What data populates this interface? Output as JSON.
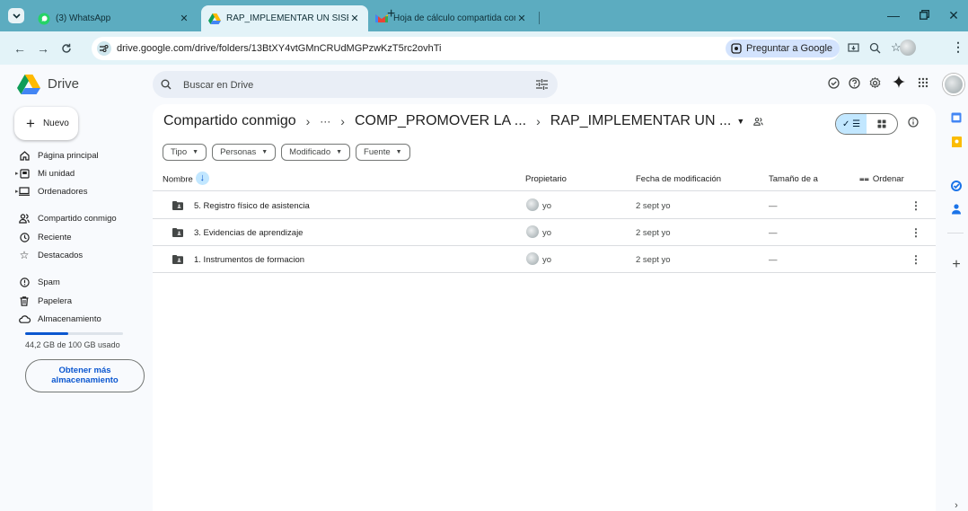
{
  "browser": {
    "tabs": [
      {
        "title": "(3) WhatsApp",
        "icon": "whatsapp-icon",
        "active": false
      },
      {
        "title": "RAP_IMPLEMENTAR UN SISEM",
        "icon": "drive-icon",
        "active": true
      },
      {
        "title": "Hoja de cálculo compartida con",
        "icon": "gmail-icon",
        "active": false
      }
    ],
    "url": "drive.google.com/drive/folders/13BtXY4vtGMnCRUdMGPzwKzT5rc2ovhTi",
    "ask_google": "Preguntar a Google",
    "colors": {
      "tabstrip": "#5cacc0",
      "toolbar": "#e3f3f8"
    }
  },
  "header": {
    "app_name": "Drive",
    "search_placeholder": "Buscar en Drive"
  },
  "sidebar": {
    "new_label": "Nuevo",
    "items": [
      {
        "label": "Página principal",
        "icon": "home-icon"
      },
      {
        "label": "Mi unidad",
        "icon": "my-drive-icon"
      },
      {
        "label": "Ordenadores",
        "icon": "computers-icon"
      },
      {
        "label": "Compartido conmigo",
        "icon": "shared-icon"
      },
      {
        "label": "Reciente",
        "icon": "clock-icon"
      },
      {
        "label": "Destacados",
        "icon": "star-icon"
      },
      {
        "label": "Spam",
        "icon": "spam-icon"
      },
      {
        "label": "Papelera",
        "icon": "trash-icon"
      },
      {
        "label": "Almacenamiento",
        "icon": "cloud-icon"
      }
    ],
    "storage_text": "44,2 GB de 100 GB usado",
    "storage_fraction": 0.442,
    "get_more_line1": "Obtener más",
    "get_more_line2": "almacenamiento"
  },
  "breadcrumb": {
    "root": "Compartido conmigo",
    "ellipsis": "···",
    "parent": "COMP_PROMOVER LA ...",
    "current": "RAP_IMPLEMENTAR UN ..."
  },
  "filters": [
    "Tipo",
    "Personas",
    "Modificado",
    "Fuente"
  ],
  "table": {
    "headers": {
      "name": "Nombre",
      "owner": "Propietario",
      "modified": "Fecha de modificación",
      "size": "Tamaño de a",
      "sort": "Ordenar"
    },
    "rows": [
      {
        "name": "5. Registro físico de asistencia",
        "owner": "yo",
        "modified": "2 sept yo",
        "size": "—"
      },
      {
        "name": "3. Evidencias de aprendizaje",
        "owner": "yo",
        "modified": "2 sept yo",
        "size": "—"
      },
      {
        "name": "1. Instrumentos de formacion",
        "owner": "yo",
        "modified": "2 sept yo",
        "size": "—"
      }
    ]
  }
}
